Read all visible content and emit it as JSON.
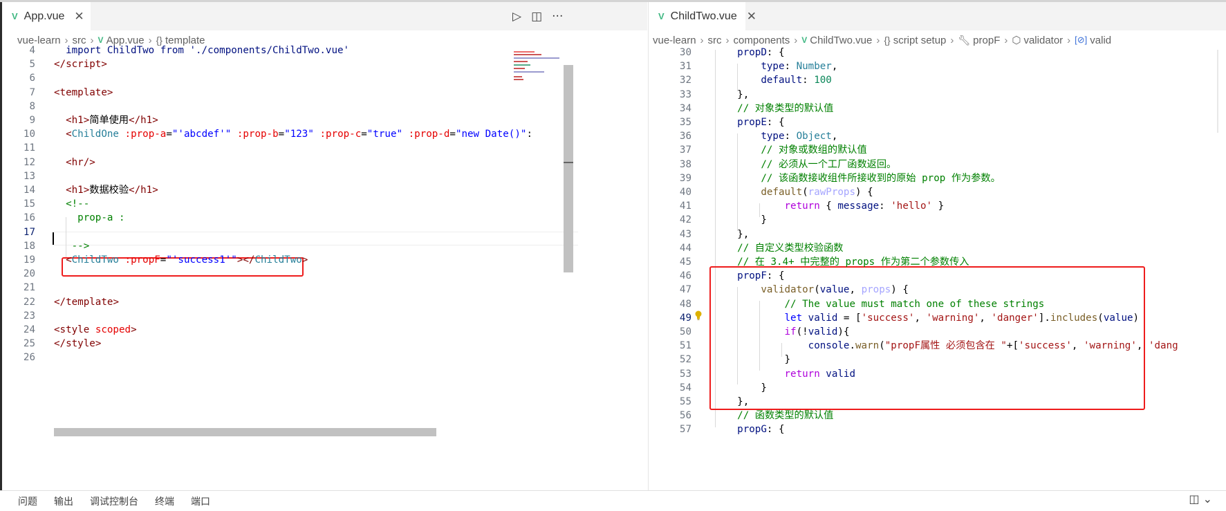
{
  "left_pane": {
    "tab": {
      "icon": "vue-file-icon",
      "label": "App.vue",
      "close": "✕"
    },
    "actions": [
      "▷",
      "◫",
      "···"
    ],
    "breadcrumb": [
      "vue-learn",
      "src",
      "App.vue",
      "template"
    ],
    "lines": [
      {
        "n": "4",
        "segments": [
          [
            "t-prop",
            "  import ChildTwo from './components/ChildTwo.vue'"
          ]
        ]
      },
      {
        "n": "5",
        "segments": [
          [
            "t-ang",
            "</"
          ],
          [
            "t-tag",
            "script"
          ],
          [
            "t-ang",
            ">"
          ]
        ]
      },
      {
        "n": "6",
        "segments": []
      },
      {
        "n": "7",
        "segments": [
          [
            "t-ang",
            "<"
          ],
          [
            "t-tag",
            "template"
          ],
          [
            "t-ang",
            ">"
          ]
        ]
      },
      {
        "n": "8",
        "segments": []
      },
      {
        "n": "9",
        "segments": [
          [
            "t-txt",
            "  "
          ],
          [
            "t-ang",
            "<"
          ],
          [
            "t-tag",
            "h1"
          ],
          [
            "t-ang",
            ">"
          ],
          [
            "t-txt",
            "简单使用"
          ],
          [
            "t-ang",
            "</"
          ],
          [
            "t-tag",
            "h1"
          ],
          [
            "t-ang",
            ">"
          ]
        ]
      },
      {
        "n": "10",
        "segments": [
          [
            "t-txt",
            "  "
          ],
          [
            "t-ang",
            "<"
          ],
          [
            "t-type",
            "ChildOne"
          ],
          [
            "t-txt",
            " "
          ],
          [
            "t-attr",
            ":prop-a"
          ],
          [
            "t-txt",
            "="
          ],
          [
            "t-str",
            "\"'abcdef'\""
          ],
          [
            "t-txt",
            " "
          ],
          [
            "t-attr",
            ":prop-b"
          ],
          [
            "t-txt",
            "="
          ],
          [
            "t-str",
            "\"123\""
          ],
          [
            "t-txt",
            " "
          ],
          [
            "t-attr",
            ":prop-c"
          ],
          [
            "t-txt",
            "="
          ],
          [
            "t-str",
            "\"true\""
          ],
          [
            "t-txt",
            " "
          ],
          [
            "t-attr",
            ":prop-d"
          ],
          [
            "t-txt",
            "="
          ],
          [
            "t-str",
            "\"new Date()\""
          ],
          [
            "t-txt",
            ":"
          ]
        ]
      },
      {
        "n": "11",
        "segments": []
      },
      {
        "n": "12",
        "segments": [
          [
            "t-txt",
            "  "
          ],
          [
            "t-ang",
            "<"
          ],
          [
            "t-tag",
            "hr"
          ],
          [
            "t-ang",
            "/>"
          ]
        ]
      },
      {
        "n": "13",
        "segments": []
      },
      {
        "n": "14",
        "segments": [
          [
            "t-txt",
            "  "
          ],
          [
            "t-ang",
            "<"
          ],
          [
            "t-tag",
            "h1"
          ],
          [
            "t-ang",
            ">"
          ],
          [
            "t-txt",
            "数据校验"
          ],
          [
            "t-ang",
            "</"
          ],
          [
            "t-tag",
            "h1"
          ],
          [
            "t-ang",
            ">"
          ]
        ]
      },
      {
        "n": "15",
        "segments": [
          [
            "t-txt",
            "  "
          ],
          [
            "t-cmt",
            "<!--"
          ]
        ]
      },
      {
        "n": "16",
        "segments": [
          [
            "t-cmt",
            "    prop-a :"
          ]
        ]
      },
      {
        "n": "17",
        "segments": [],
        "active": true
      },
      {
        "n": "18",
        "segments": [
          [
            "t-cmt",
            "   -->"
          ]
        ]
      },
      {
        "n": "19",
        "segments": [
          [
            "t-txt",
            "  "
          ],
          [
            "t-ang",
            "<"
          ],
          [
            "t-type",
            "ChildTwo"
          ],
          [
            "t-txt",
            " "
          ],
          [
            "t-attr",
            ":propF"
          ],
          [
            "t-txt",
            "="
          ],
          [
            "t-str",
            "\"'success1'\""
          ],
          [
            "t-ang",
            "></"
          ],
          [
            "t-type",
            "ChildTwo"
          ],
          [
            "t-ang",
            ">"
          ]
        ]
      },
      {
        "n": "20",
        "segments": []
      },
      {
        "n": "21",
        "segments": []
      },
      {
        "n": "22",
        "segments": [
          [
            "t-ang",
            "</"
          ],
          [
            "t-tag",
            "template"
          ],
          [
            "t-ang",
            ">"
          ]
        ]
      },
      {
        "n": "23",
        "segments": []
      },
      {
        "n": "24",
        "segments": [
          [
            "t-ang",
            "<"
          ],
          [
            "t-tag",
            "style"
          ],
          [
            "t-txt",
            " "
          ],
          [
            "t-scoped",
            "scoped"
          ],
          [
            "t-ang",
            ">"
          ]
        ]
      },
      {
        "n": "25",
        "segments": [
          [
            "t-ang",
            "</"
          ],
          [
            "t-tag",
            "style"
          ],
          [
            "t-ang",
            ">"
          ]
        ]
      },
      {
        "n": "26",
        "segments": []
      }
    ]
  },
  "right_pane": {
    "tab": {
      "icon": "vue-file-icon",
      "label": "ChildTwo.vue",
      "close": "✕"
    },
    "breadcrumb": [
      "vue-learn",
      "src",
      "components",
      "ChildTwo.vue",
      "script setup",
      "propF",
      "validator",
      "valid"
    ],
    "lines": [
      {
        "n": "30",
        "segments": [
          [
            "t-prop",
            "    propD"
          ],
          [
            "t-txt",
            ": {"
          ]
        ]
      },
      {
        "n": "31",
        "segments": [
          [
            "t-prop",
            "        type"
          ],
          [
            "t-txt",
            ": "
          ],
          [
            "t-type",
            "Number"
          ],
          [
            "t-txt",
            ","
          ]
        ]
      },
      {
        "n": "32",
        "segments": [
          [
            "t-prop",
            "        default"
          ],
          [
            "t-txt",
            ": "
          ],
          [
            "t-num",
            "100"
          ]
        ]
      },
      {
        "n": "33",
        "segments": [
          [
            "t-txt",
            "    },"
          ]
        ]
      },
      {
        "n": "34",
        "segments": [
          [
            "t-cmt",
            "    // 对象类型的默认值"
          ]
        ]
      },
      {
        "n": "35",
        "segments": [
          [
            "t-prop",
            "    propE"
          ],
          [
            "t-txt",
            ": {"
          ]
        ]
      },
      {
        "n": "36",
        "segments": [
          [
            "t-prop",
            "        type"
          ],
          [
            "t-txt",
            ": "
          ],
          [
            "t-type",
            "Object"
          ],
          [
            "t-txt",
            ","
          ]
        ]
      },
      {
        "n": "37",
        "segments": [
          [
            "t-cmt",
            "        // 对象或数组的默认值"
          ]
        ]
      },
      {
        "n": "38",
        "segments": [
          [
            "t-cmt",
            "        // 必须从一个工厂函数返回。"
          ]
        ]
      },
      {
        "n": "39",
        "segments": [
          [
            "t-cmt",
            "        // 该函数接收组件所接收到的原始 prop 作为参数。"
          ]
        ]
      },
      {
        "n": "40",
        "segments": [
          [
            "t-fn",
            "        default"
          ],
          [
            "t-txt",
            "("
          ],
          [
            "t-param",
            "rawProps"
          ],
          [
            "t-txt",
            ") {"
          ]
        ]
      },
      {
        "n": "41",
        "segments": [
          [
            "t-ctl",
            "            return"
          ],
          [
            "t-txt",
            " { "
          ],
          [
            "t-prop",
            "message"
          ],
          [
            "t-txt",
            ": "
          ],
          [
            "t-sq",
            "'hello'"
          ],
          [
            "t-txt",
            " }"
          ]
        ]
      },
      {
        "n": "42",
        "segments": [
          [
            "t-txt",
            "        }"
          ]
        ]
      },
      {
        "n": "43",
        "segments": [
          [
            "t-txt",
            "    },"
          ]
        ]
      },
      {
        "n": "44",
        "segments": [
          [
            "t-cmt",
            "    // 自定义类型校验函数"
          ]
        ]
      },
      {
        "n": "45",
        "segments": [
          [
            "t-cmt",
            "    // 在 3.4+ 中完整的 props 作为第二个参数传入"
          ]
        ]
      },
      {
        "n": "46",
        "segments": [
          [
            "t-prop",
            "    propF"
          ],
          [
            "t-txt",
            ": {"
          ]
        ]
      },
      {
        "n": "47",
        "segments": [
          [
            "t-fn",
            "        validator"
          ],
          [
            "t-txt",
            "("
          ],
          [
            "t-paramB",
            "value"
          ],
          [
            "t-txt",
            ", "
          ],
          [
            "t-param",
            "props"
          ],
          [
            "t-txt",
            ") {"
          ]
        ]
      },
      {
        "n": "48",
        "segments": [
          [
            "t-cmt",
            "            // The value must match one of these strings"
          ]
        ]
      },
      {
        "n": "49",
        "segments": [
          [
            "t-kw",
            "            let"
          ],
          [
            "t-txt",
            " "
          ],
          [
            "t-prop",
            "valid"
          ],
          [
            "t-txt",
            " = ["
          ],
          [
            "t-sq",
            "'success'"
          ],
          [
            "t-txt",
            ", "
          ],
          [
            "t-sq",
            "'warning'"
          ],
          [
            "t-txt",
            ", "
          ],
          [
            "t-sq",
            "'danger'"
          ],
          [
            "t-txt",
            "]."
          ],
          [
            "t-fn",
            "includes"
          ],
          [
            "t-txt",
            "("
          ],
          [
            "t-paramB",
            "value"
          ],
          [
            "t-txt",
            ")"
          ]
        ],
        "active": true
      },
      {
        "n": "50",
        "segments": [
          [
            "t-ctl",
            "            if"
          ],
          [
            "t-txt",
            "(!"
          ],
          [
            "t-prop",
            "valid"
          ],
          [
            "t-txt",
            "){"
          ]
        ]
      },
      {
        "n": "51",
        "segments": [
          [
            "t-prop",
            "                console"
          ],
          [
            "t-txt",
            "."
          ],
          [
            "t-fn",
            "warn"
          ],
          [
            "t-txt",
            "("
          ],
          [
            "t-sq",
            "\"propF属性 必须包含在 \""
          ],
          [
            "t-txt",
            "+["
          ],
          [
            "t-sq",
            "'success'"
          ],
          [
            "t-txt",
            ", "
          ],
          [
            "t-sq",
            "'warning'"
          ],
          [
            "t-txt",
            ", "
          ],
          [
            "t-sq",
            "'dang"
          ]
        ]
      },
      {
        "n": "52",
        "segments": [
          [
            "t-txt",
            "            }"
          ]
        ]
      },
      {
        "n": "53",
        "segments": [
          [
            "t-ctl",
            "            return"
          ],
          [
            "t-txt",
            " "
          ],
          [
            "t-prop",
            "valid"
          ]
        ]
      },
      {
        "n": "54",
        "segments": [
          [
            "t-txt",
            "        }"
          ]
        ]
      },
      {
        "n": "55",
        "segments": [
          [
            "t-txt",
            "    },"
          ]
        ]
      },
      {
        "n": "56",
        "segments": [
          [
            "t-cmt",
            "    // 函数类型的默认值"
          ]
        ]
      },
      {
        "n": "57",
        "segments": [
          [
            "t-prop",
            "    propG"
          ],
          [
            "t-txt",
            ": {"
          ]
        ]
      }
    ]
  },
  "bottom_panel": {
    "tabs": [
      "问题",
      "输出",
      "调试控制台",
      "终端",
      "端口"
    ]
  },
  "colors": {
    "highlight_box": "#ee1c1c",
    "vue_green": "#41b883"
  }
}
